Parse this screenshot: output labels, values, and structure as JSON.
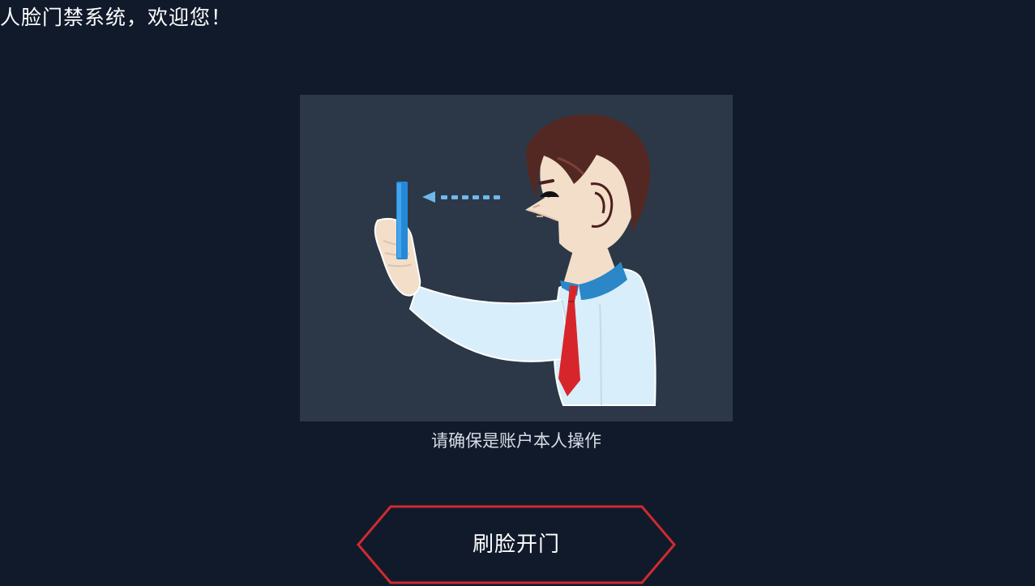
{
  "header": {
    "title": "人脸门禁系统，欢迎您！"
  },
  "illustration": {
    "icon": "person-face-scan-illustration"
  },
  "hint": {
    "text": "请确保是账户本人操作"
  },
  "actions": {
    "face_unlock_label": "刷脸开门"
  },
  "colors": {
    "background": "#111a2b",
    "panel": "#2c3847",
    "button_border": "#cf2b2e",
    "phone": "#2389d8",
    "tie": "#d7262b",
    "collar": "#2b87c8"
  }
}
